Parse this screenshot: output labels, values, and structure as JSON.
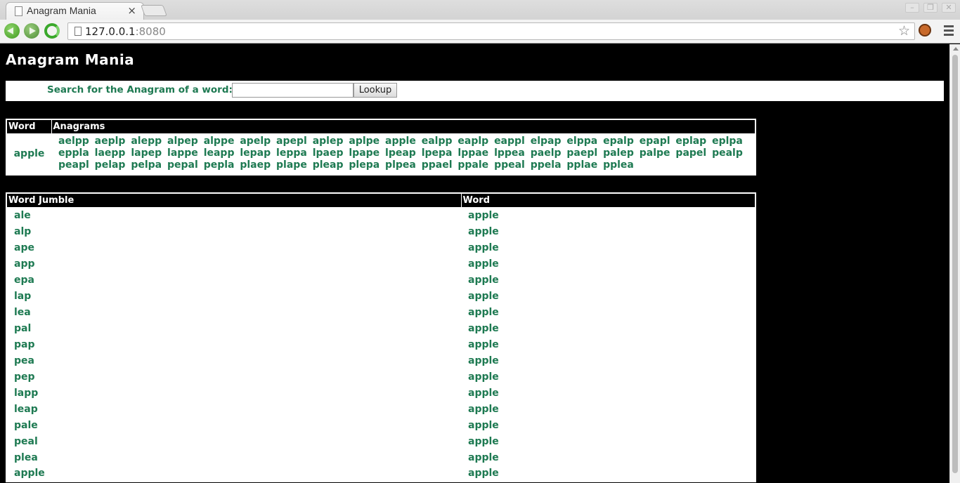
{
  "browser": {
    "tab_title": "Anagram Mania",
    "tab_close": "×",
    "url_host": "127.0.0.1",
    "url_port": ":8080"
  },
  "page": {
    "title": "Anagram Mania",
    "search_label": "Search for the Anagram of a word:",
    "search_value": "",
    "lookup_button": "Lookup"
  },
  "anagram_table": {
    "headers": [
      "Word",
      "Anagrams"
    ],
    "word": "apple",
    "anagrams": [
      "aelpp",
      "aeplp",
      "alepp",
      "alpep",
      "alppe",
      "apelp",
      "apepl",
      "aplep",
      "aplpe",
      "apple",
      "ealpp",
      "eaplp",
      "eappl",
      "elpap",
      "elppa",
      "epalp",
      "epapl",
      "eplap",
      "eplpa",
      "eppla",
      "laepp",
      "lapep",
      "lappe",
      "leapp",
      "lepap",
      "leppa",
      "lpaep",
      "lpape",
      "lpeap",
      "lpepa",
      "lppae",
      "lppea",
      "paelp",
      "paepl",
      "palep",
      "palpe",
      "papel",
      "pealp",
      "peapl",
      "pelap",
      "pelpa",
      "pepal",
      "pepla",
      "plaep",
      "plape",
      "pleap",
      "plepa",
      "plpea",
      "ppael",
      "ppale",
      "ppeal",
      "ppela",
      "pplae",
      "pplea"
    ]
  },
  "jumble_table": {
    "headers": [
      "Word Jumble",
      "Word"
    ],
    "rows": [
      {
        "jumble": "ale",
        "word": "apple"
      },
      {
        "jumble": "alp",
        "word": "apple"
      },
      {
        "jumble": "ape",
        "word": "apple"
      },
      {
        "jumble": "app",
        "word": "apple"
      },
      {
        "jumble": "epa",
        "word": "apple"
      },
      {
        "jumble": "lap",
        "word": "apple"
      },
      {
        "jumble": "lea",
        "word": "apple"
      },
      {
        "jumble": "pal",
        "word": "apple"
      },
      {
        "jumble": "pap",
        "word": "apple"
      },
      {
        "jumble": "pea",
        "word": "apple"
      },
      {
        "jumble": "pep",
        "word": "apple"
      },
      {
        "jumble": "lapp",
        "word": "apple"
      },
      {
        "jumble": "leap",
        "word": "apple"
      },
      {
        "jumble": "pale",
        "word": "apple"
      },
      {
        "jumble": "peal",
        "word": "apple"
      },
      {
        "jumble": "plea",
        "word": "apple"
      },
      {
        "jumble": "apple",
        "word": "apple"
      }
    ]
  }
}
